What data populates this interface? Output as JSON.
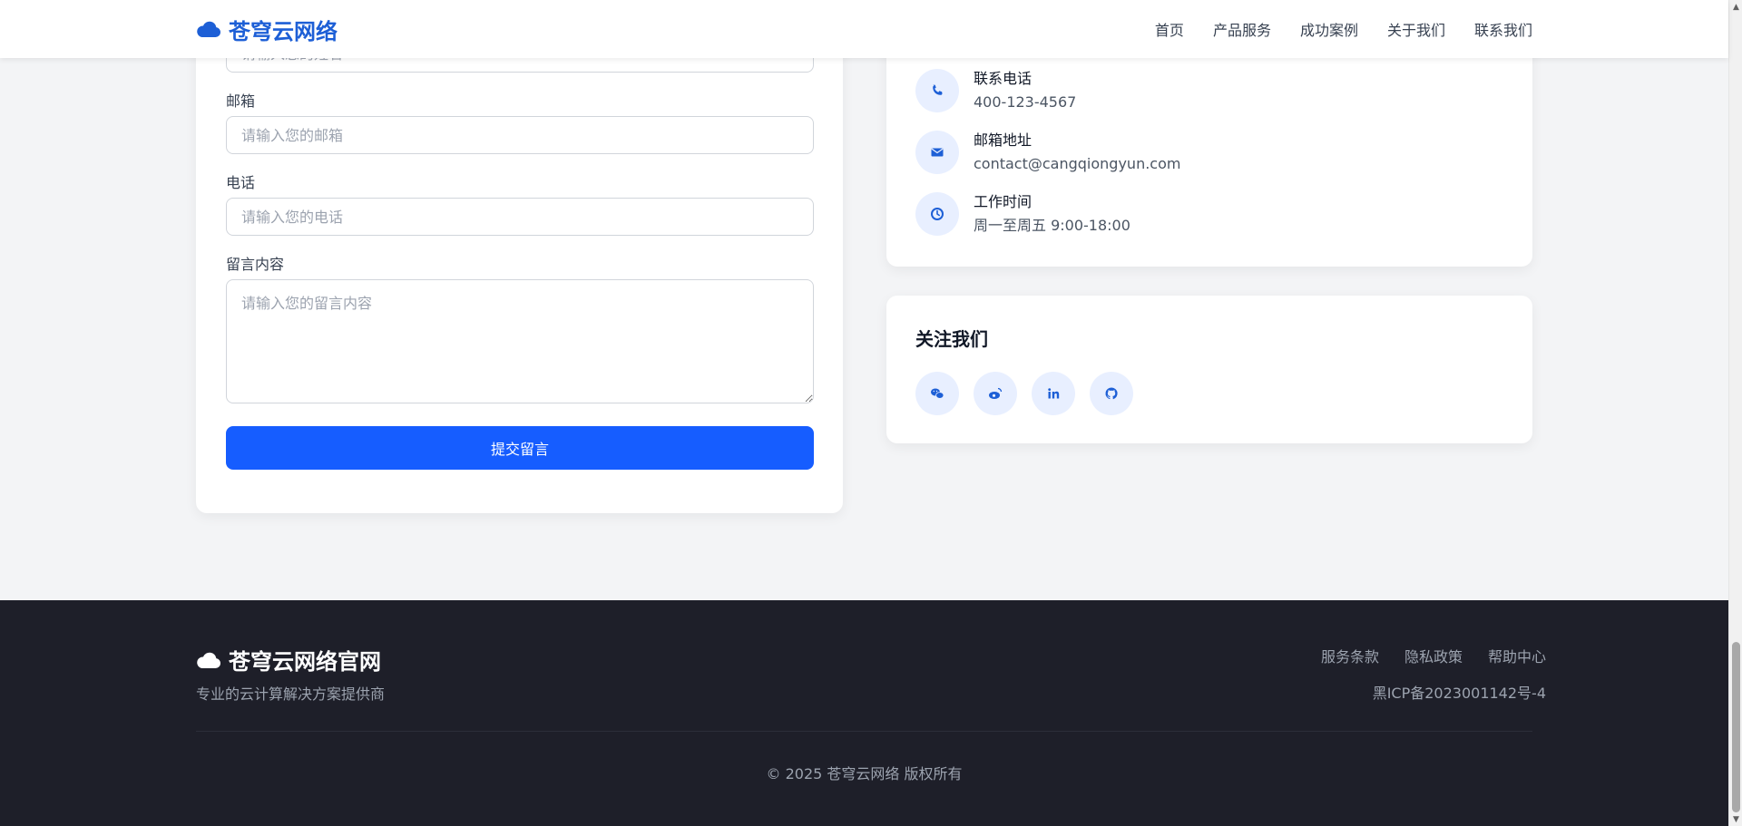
{
  "header": {
    "brand": "苍穹云网络",
    "nav": [
      "首页",
      "产品服务",
      "成功案例",
      "关于我们",
      "联系我们"
    ]
  },
  "form": {
    "name_placeholder": "请输入您的姓名",
    "email_label": "邮箱",
    "email_placeholder": "请输入您的邮箱",
    "phone_label": "电话",
    "phone_placeholder": "请输入您的电话",
    "message_label": "留言内容",
    "message_placeholder": "请输入您的留言内容",
    "submit_label": "提交留言"
  },
  "contact": {
    "phone_title": "联系电话",
    "phone_value": "400-123-4567",
    "email_title": "邮箱地址",
    "email_value": "contact@cangqiongyun.com",
    "hours_title": "工作时间",
    "hours_value": "周一至周五 9:00-18:00"
  },
  "follow": {
    "title": "关注我们",
    "icons": [
      "wechat-icon",
      "weibo-icon",
      "linkedin-icon",
      "github-icon"
    ]
  },
  "footer": {
    "brand": "苍穹云网络官网",
    "tagline": "专业的云计算解决方案提供商",
    "links": [
      "服务条款",
      "隐私政策",
      "帮助中心"
    ],
    "icp": "黑ICP备2023001142号-4",
    "copyright": "© 2025 苍穹云网络 版权所有"
  },
  "colors": {
    "brand_blue": "#1d5fd6",
    "button_blue": "#165dff",
    "footer_bg": "#1e1f29",
    "page_bg": "#f3f4f6"
  }
}
